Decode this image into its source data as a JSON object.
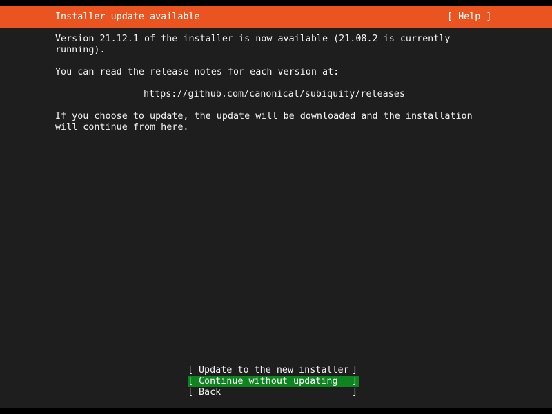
{
  "header": {
    "title": "Installer update available",
    "help_label": "[ Help ]"
  },
  "body": {
    "paragraph1_line1": "Version 21.12.1 of the installer is now available (21.08.2 is currently",
    "paragraph1_line2": "running).",
    "paragraph2": "You can read the release notes for each version at:",
    "release_url": "https://github.com/canonical/subiquity/releases",
    "paragraph3_line1": "If you choose to update, the update will be downloaded and the installation",
    "paragraph3_line2": "will continue from here."
  },
  "buttons": {
    "left_bracket": "[",
    "right_bracket": "]",
    "update_label": "Update to the new installer",
    "continue_label": "Continue without updating",
    "back_label": "Back",
    "selected": "continue"
  },
  "colors": {
    "title_bar": "#e95420",
    "selected_button": "#0e8420",
    "background": "#1e1e1e",
    "text": "#f2f2f2"
  }
}
